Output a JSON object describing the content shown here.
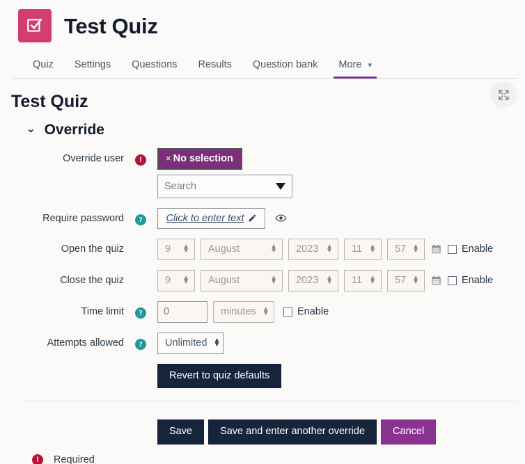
{
  "header": {
    "activity_icon": "quiz-checkbox-icon",
    "title": "Test Quiz",
    "icon_color": "#d43d72"
  },
  "nav": {
    "tabs": [
      {
        "label": "Quiz",
        "active": false
      },
      {
        "label": "Settings",
        "active": false
      },
      {
        "label": "Questions",
        "active": false
      },
      {
        "label": "Results",
        "active": false
      },
      {
        "label": "Question bank",
        "active": false
      },
      {
        "label": "More",
        "active": true,
        "has_chevron": true
      }
    ],
    "active_underline_color": "#76328c"
  },
  "main": {
    "page_title": "Test Quiz",
    "expand_button_icon": "expand-arrows-icon",
    "section": {
      "title": "Override",
      "collapse_icon": "chevron-down-icon",
      "expanded": true
    },
    "fields": {
      "override_user": {
        "label": "Override user",
        "indicator": "required-icon",
        "selection_tag": "No selection",
        "selection_tag_remove": "×",
        "search_placeholder": "Search",
        "dropdown_icon": "caret-down-icon"
      },
      "require_password": {
        "label": "Require password",
        "indicator": "help-icon",
        "value": "Click to enter text",
        "edit_icon": "pencil-icon",
        "reveal_icon": "eye-icon"
      },
      "open_the_quiz": {
        "label": "Open the quiz",
        "day": "9",
        "month": "August",
        "year": "2023",
        "hour": "11",
        "minute": "57",
        "calendar_icon": "calendar-icon",
        "enable_label": "Enable",
        "enabled": false
      },
      "close_the_quiz": {
        "label": "Close the quiz",
        "day": "9",
        "month": "August",
        "year": "2023",
        "hour": "11",
        "minute": "57",
        "calendar_icon": "calendar-icon",
        "enable_label": "Enable",
        "enabled": false
      },
      "time_limit": {
        "label": "Time limit",
        "indicator": "help-icon",
        "value": "0",
        "unit": "minutes",
        "enable_label": "Enable",
        "enabled": false
      },
      "attempts_allowed": {
        "label": "Attempts allowed",
        "indicator": "help-icon",
        "value": "Unlimited"
      }
    },
    "buttons": {
      "revert": "Revert to quiz defaults",
      "save": "Save",
      "save_another": "Save and enter another override",
      "cancel": "Cancel"
    },
    "footer": {
      "required_icon": "required-icon",
      "required_text": "Required"
    }
  },
  "colors": {
    "brand_purple": "#76328c",
    "dark_navy": "#16243c",
    "pink": "#d43d72",
    "teal_help": "#1f9a96",
    "required_red": "#b81237"
  }
}
